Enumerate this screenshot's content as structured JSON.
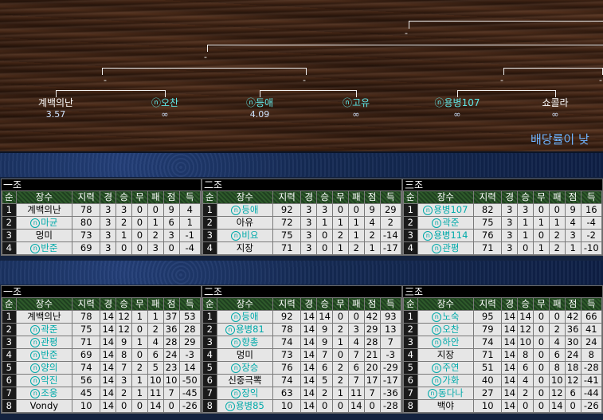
{
  "bracket": {
    "players": [
      {
        "name": "계백의난",
        "odds": "3.57",
        "cyan": false
      },
      {
        "name": "오찬",
        "odds": "∞",
        "cyan": true
      },
      {
        "name": "등애",
        "odds": "4.09",
        "cyan": true
      },
      {
        "name": "고유",
        "odds": "∞",
        "cyan": true
      },
      {
        "name": "용병107",
        "odds": "∞",
        "cyan": true
      },
      {
        "name": "쇼콜라",
        "odds": "∞",
        "cyan": false
      }
    ],
    "match_marks": [
      "-",
      "-",
      "-",
      "-",
      "-",
      "-"
    ],
    "notice": "배당률이 낮"
  },
  "headers": [
    "순",
    "장수",
    "지력",
    "경",
    "승",
    "무",
    "패",
    "점",
    "득"
  ],
  "rank_tables": [
    {
      "title": "一조",
      "rows": [
        [
          "1",
          "계백의난",
          "78",
          "3",
          "3",
          "0",
          "0",
          "9",
          "4",
          false
        ],
        [
          "2",
          "마균",
          "80",
          "3",
          "2",
          "0",
          "1",
          "6",
          "1",
          true
        ],
        [
          "3",
          "멍미",
          "73",
          "3",
          "1",
          "0",
          "2",
          "3",
          "-1",
          false
        ],
        [
          "4",
          "반준",
          "69",
          "3",
          "0",
          "0",
          "3",
          "0",
          "-4",
          true
        ]
      ]
    },
    {
      "title": "二조",
      "rows": [
        [
          "1",
          "등애",
          "92",
          "3",
          "3",
          "0",
          "0",
          "9",
          "29",
          true
        ],
        [
          "2",
          "아유",
          "72",
          "3",
          "1",
          "1",
          "1",
          "4",
          "2",
          false
        ],
        [
          "3",
          "비요",
          "75",
          "3",
          "0",
          "2",
          "1",
          "2",
          "-14",
          true
        ],
        [
          "4",
          "지장",
          "71",
          "3",
          "0",
          "1",
          "2",
          "1",
          "-17",
          false
        ]
      ]
    },
    {
      "title": "三조",
      "rows": [
        [
          "1",
          "용병107",
          "82",
          "3",
          "3",
          "0",
          "0",
          "9",
          "16",
          true
        ],
        [
          "2",
          "곽준",
          "75",
          "3",
          "1",
          "1",
          "1",
          "4",
          "-4",
          true
        ],
        [
          "3",
          "용병114",
          "76",
          "3",
          "1",
          "0",
          "2",
          "3",
          "-2",
          true
        ],
        [
          "4",
          "관평",
          "71",
          "3",
          "0",
          "1",
          "2",
          "1",
          "-10",
          true
        ]
      ]
    }
  ],
  "league_tables": [
    {
      "title": "一조",
      "rows": [
        [
          "1",
          "계백의난",
          "78",
          "14",
          "12",
          "1",
          "1",
          "37",
          "53",
          false
        ],
        [
          "2",
          "곽준",
          "75",
          "14",
          "12",
          "0",
          "2",
          "36",
          "28",
          true
        ],
        [
          "3",
          "관평",
          "71",
          "14",
          "9",
          "1",
          "4",
          "28",
          "29",
          true
        ],
        [
          "4",
          "반준",
          "69",
          "14",
          "8",
          "0",
          "6",
          "24",
          "-3",
          true
        ],
        [
          "5",
          "양의",
          "74",
          "14",
          "7",
          "2",
          "5",
          "23",
          "14",
          true
        ],
        [
          "6",
          "악진",
          "56",
          "14",
          "3",
          "1",
          "10",
          "10",
          "-50",
          true
        ],
        [
          "7",
          "조웅",
          "45",
          "14",
          "2",
          "1",
          "11",
          "7",
          "-45",
          true
        ],
        [
          "8",
          "Vondy",
          "10",
          "14",
          "0",
          "0",
          "14",
          "0",
          "-26",
          false
        ]
      ]
    },
    {
      "title": "二조",
      "rows": [
        [
          "1",
          "등애",
          "92",
          "14",
          "14",
          "0",
          "0",
          "42",
          "93",
          true
        ],
        [
          "2",
          "용병81",
          "78",
          "14",
          "9",
          "2",
          "3",
          "29",
          "13",
          true
        ],
        [
          "3",
          "향총",
          "74",
          "14",
          "9",
          "1",
          "4",
          "28",
          "7",
          true
        ],
        [
          "4",
          "멍미",
          "73",
          "14",
          "7",
          "0",
          "7",
          "21",
          "-3",
          false
        ],
        [
          "5",
          "장승",
          "76",
          "14",
          "6",
          "2",
          "6",
          "20",
          "-29",
          true
        ],
        [
          "6",
          "신중극뽁",
          "74",
          "14",
          "5",
          "2",
          "7",
          "17",
          "-17",
          false
        ],
        [
          "7",
          "장익",
          "63",
          "14",
          "2",
          "1",
          "11",
          "7",
          "-36",
          true
        ],
        [
          "8",
          "용병85",
          "10",
          "14",
          "0",
          "0",
          "14",
          "0",
          "-28",
          true
        ]
      ]
    },
    {
      "title": "三조",
      "rows": [
        [
          "1",
          "노숙",
          "95",
          "14",
          "14",
          "0",
          "0",
          "42",
          "66",
          true
        ],
        [
          "2",
          "오찬",
          "79",
          "14",
          "12",
          "0",
          "2",
          "36",
          "41",
          true
        ],
        [
          "3",
          "하안",
          "74",
          "14",
          "10",
          "0",
          "4",
          "30",
          "24",
          true
        ],
        [
          "4",
          "지장",
          "71",
          "14",
          "8",
          "0",
          "6",
          "24",
          "8",
          false
        ],
        [
          "5",
          "주연",
          "51",
          "14",
          "6",
          "0",
          "8",
          "18",
          "-28",
          true
        ],
        [
          "6",
          "가화",
          "40",
          "14",
          "4",
          "0",
          "10",
          "12",
          "-41",
          true
        ],
        [
          "7",
          "동다나",
          "27",
          "14",
          "2",
          "0",
          "12",
          "6",
          "-44",
          true
        ],
        [
          "8",
          "백야",
          "10",
          "14",
          "0",
          "0",
          "14",
          "0",
          "-26",
          false
        ]
      ]
    }
  ]
}
